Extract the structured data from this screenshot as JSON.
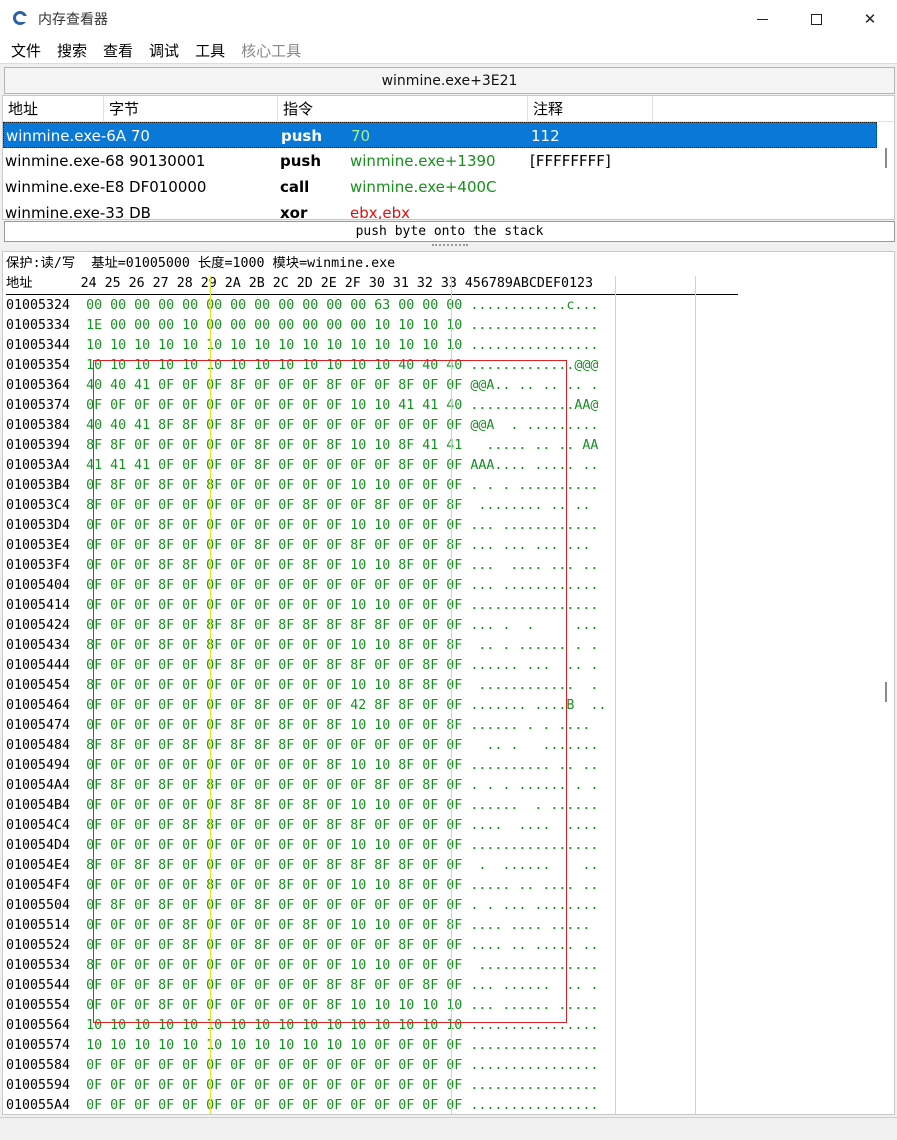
{
  "window": {
    "title": "内存查看器"
  },
  "menu": [
    "文件",
    "搜索",
    "查看",
    "调试",
    "工具",
    "核心工具"
  ],
  "address_bar": "winmine.exe+3E21",
  "disasm": {
    "headers": [
      "地址",
      "字节",
      "指令",
      "注释"
    ],
    "rows": [
      {
        "addr": "winmine.exe-6A 70",
        "mnem": "push",
        "operand": "70",
        "operand_color": "green",
        "comment": "112",
        "selected": true
      },
      {
        "addr": "winmine.exe-68 90130001",
        "mnem": "push",
        "operand": "winmine.exe+1390",
        "operand_color": "green",
        "comment": "[FFFFFFFF]",
        "selected": false
      },
      {
        "addr": "winmine.exe-E8 DF010000",
        "mnem": "call",
        "operand": "winmine.exe+400C",
        "operand_color": "green",
        "comment": "",
        "selected": false
      },
      {
        "addr": "winmine.exe-33 DB",
        "mnem": "xor",
        "operand": "ebx,ebx",
        "operand_color": "red",
        "comment": "",
        "selected": false
      }
    ]
  },
  "status_line": "push byte onto the stack",
  "hex": {
    "info_line": "保护:读/写  基址=01005000 长度=1000 模块=winmine.exe",
    "header_line": "地址      24 25 26 27 28 29 2A 2B 2C 2D 2E 2F 30 31 32 33 456789ABCDEF0123",
    "rows": [
      {
        "addr": "01005324",
        "bytes": "00 00 00 00 00 00 00 00 00 00 00 00 63 00 00 00",
        "text": "............c..."
      },
      {
        "addr": "01005334",
        "bytes": "1E 00 00 00 10 00 00 00 00 00 00 00 10 10 10 10",
        "text": "................"
      },
      {
        "addr": "01005344",
        "bytes": "10 10 10 10 10 10 10 10 10 10 10 10 10 10 10 10",
        "text": "................"
      },
      {
        "addr": "01005354",
        "bytes": "10 10 10 10 10 10 10 10 10 10 10 10 10 40 40 40",
        "text": ".............@@@"
      },
      {
        "addr": "01005364",
        "bytes": "40 40 41 0F 0F 0F 8F 0F 0F 0F 8F 0F 0F 8F 0F 0F",
        "text": "@@A.. .. .. .. ."
      },
      {
        "addr": "01005374",
        "bytes": "0F 0F 0F 0F 0F 0F 0F 0F 0F 0F 0F 10 10 41 41 40",
        "text": ".............AA@"
      },
      {
        "addr": "01005384",
        "bytes": "40 40 41 8F 8F 0F 8F 0F 0F 0F 0F 0F 0F 0F 0F 0F",
        "text": "@@A  . ........."
      },
      {
        "addr": "01005394",
        "bytes": "8F 8F 0F 0F 0F 0F 0F 8F 0F 0F 8F 10 10 8F 41 41",
        "text": "  ..... .. .. AA"
      },
      {
        "addr": "010053A4",
        "bytes": "41 41 41 0F 0F 0F 0F 8F 0F 0F 0F 0F 0F 8F 0F 0F",
        "text": "AAA.... ..... .."
      },
      {
        "addr": "010053B4",
        "bytes": "0F 8F 0F 8F 0F 8F 0F 0F 0F 0F 0F 10 10 0F 0F 0F",
        "text": ". . . .........."
      },
      {
        "addr": "010053C4",
        "bytes": "8F 0F 0F 0F 0F 0F 0F 0F 0F 8F 0F 0F 8F 0F 0F 8F",
        "text": " ........ .. .. "
      },
      {
        "addr": "010053D4",
        "bytes": "0F 0F 0F 8F 0F 0F 0F 0F 0F 0F 0F 10 10 0F 0F 0F",
        "text": "... ............"
      },
      {
        "addr": "010053E4",
        "bytes": "0F 0F 0F 8F 0F 0F 0F 8F 0F 0F 0F 8F 0F 0F 0F 8F",
        "text": "... ... ... ... "
      },
      {
        "addr": "010053F4",
        "bytes": "0F 0F 0F 8F 8F 0F 0F 0F 0F 8F 0F 10 10 8F 0F 0F",
        "text": "...  .... ... .."
      },
      {
        "addr": "01005404",
        "bytes": "0F 0F 0F 8F 0F 0F 0F 0F 0F 0F 0F 0F 0F 0F 0F 0F",
        "text": "... ............"
      },
      {
        "addr": "01005414",
        "bytes": "0F 0F 0F 0F 0F 0F 0F 0F 0F 0F 0F 10 10 0F 0F 0F",
        "text": "................"
      },
      {
        "addr": "01005424",
        "bytes": "0F 0F 0F 8F 0F 8F 8F 0F 8F 8F 8F 8F 8F 0F 0F 0F",
        "text": "... .  .     ..."
      },
      {
        "addr": "01005434",
        "bytes": "8F 0F 0F 8F 0F 8F 0F 0F 0F 0F 0F 10 10 8F 0F 8F",
        "text": " .. . ...... . ."
      },
      {
        "addr": "01005444",
        "bytes": "0F 0F 0F 0F 0F 0F 8F 0F 0F 0F 8F 8F 0F 0F 8F 0F",
        "text": "...... ...  .. ."
      },
      {
        "addr": "01005454",
        "bytes": "8F 0F 0F 0F 0F 0F 0F 0F 0F 0F 0F 10 10 8F 8F 0F",
        "text": " ............  ."
      },
      {
        "addr": "01005464",
        "bytes": "0F 0F 0F 0F 0F 0F 0F 8F 0F 0F 0F 42 8F 8F 0F 0F",
        "text": "....... ....B  .."
      },
      {
        "addr": "01005474",
        "bytes": "0F 0F 0F 0F 0F 0F 8F 0F 8F 0F 8F 10 10 0F 0F 8F",
        "text": "...... . . .... "
      },
      {
        "addr": "01005484",
        "bytes": "8F 8F 0F 0F 8F 0F 8F 8F 8F 0F 0F 0F 0F 0F 0F 0F",
        "text": "  .. .   ......."
      },
      {
        "addr": "01005494",
        "bytes": "0F 0F 0F 0F 0F 0F 0F 0F 0F 0F 8F 10 10 8F 0F 0F",
        "text": ".......... .. .."
      },
      {
        "addr": "010054A4",
        "bytes": "0F 8F 0F 8F 0F 8F 0F 0F 0F 0F 0F 0F 8F 0F 8F 0F",
        "text": ". . . ...... . ."
      },
      {
        "addr": "010054B4",
        "bytes": "0F 0F 0F 0F 0F 0F 8F 8F 0F 8F 0F 10 10 0F 0F 0F",
        "text": "......  . ......"
      },
      {
        "addr": "010054C4",
        "bytes": "0F 0F 0F 0F 8F 8F 0F 0F 0F 0F 8F 8F 0F 0F 0F 0F",
        "text": "....  ....  ...."
      },
      {
        "addr": "010054D4",
        "bytes": "0F 0F 0F 0F 0F 0F 0F 0F 0F 0F 0F 10 10 0F 0F 0F",
        "text": "................"
      },
      {
        "addr": "010054E4",
        "bytes": "8F 0F 8F 8F 0F 0F 0F 0F 0F 0F 8F 8F 8F 8F 0F 0F",
        "text": " .  ......    .."
      },
      {
        "addr": "010054F4",
        "bytes": "0F 0F 0F 0F 0F 8F 0F 0F 8F 0F 0F 10 10 8F 0F 0F",
        "text": "..... .. .... .."
      },
      {
        "addr": "01005504",
        "bytes": "0F 8F 0F 8F 0F 0F 0F 8F 0F 0F 0F 0F 0F 0F 0F 0F",
        "text": ". . ... ........"
      },
      {
        "addr": "01005514",
        "bytes": "0F 0F 0F 0F 8F 0F 0F 0F 0F 8F 0F 10 10 0F 0F 8F",
        "text": ".... .... ..... "
      },
      {
        "addr": "01005524",
        "bytes": "0F 0F 0F 0F 8F 0F 0F 8F 0F 0F 0F 0F 0F 8F 0F 0F",
        "text": ".... .. ..... .."
      },
      {
        "addr": "01005534",
        "bytes": "8F 0F 0F 0F 0F 0F 0F 0F 0F 0F 0F 10 10 0F 0F 0F",
        "text": " ..............."
      },
      {
        "addr": "01005544",
        "bytes": "0F 0F 0F 8F 0F 0F 0F 0F 0F 0F 8F 8F 0F 0F 8F 0F",
        "text": "... ......  .. ."
      },
      {
        "addr": "01005554",
        "bytes": "0F 0F 0F 8F 0F 0F 0F 0F 0F 0F 8F 10 10 10 10 10",
        "text": "... ...... ....."
      },
      {
        "addr": "01005564",
        "bytes": "10 10 10 10 10 10 10 10 10 10 10 10 10 10 10 10",
        "text": "................"
      },
      {
        "addr": "01005574",
        "bytes": "10 10 10 10 10 10 10 10 10 10 10 10 0F 0F 0F 0F",
        "text": "................"
      },
      {
        "addr": "01005584",
        "bytes": "0F 0F 0F 0F 0F 0F 0F 0F 0F 0F 0F 0F 0F 0F 0F 0F",
        "text": "................"
      },
      {
        "addr": "01005594",
        "bytes": "0F 0F 0F 0F 0F 0F 0F 0F 0F 0F 0F 0F 0F 0F 0F 0F",
        "text": "................"
      },
      {
        "addr": "010055A4",
        "bytes": "0F 0F 0F 0F 0F 0F 0F 0F 0F 0F 0F 0F 0F 0F 0F 0F",
        "text": "................"
      }
    ]
  },
  "colors": {
    "selection": "#0a78d7",
    "hex_bytes": "#15901f",
    "highlight_box": "#e02020",
    "column_guides": "#e8e820"
  }
}
